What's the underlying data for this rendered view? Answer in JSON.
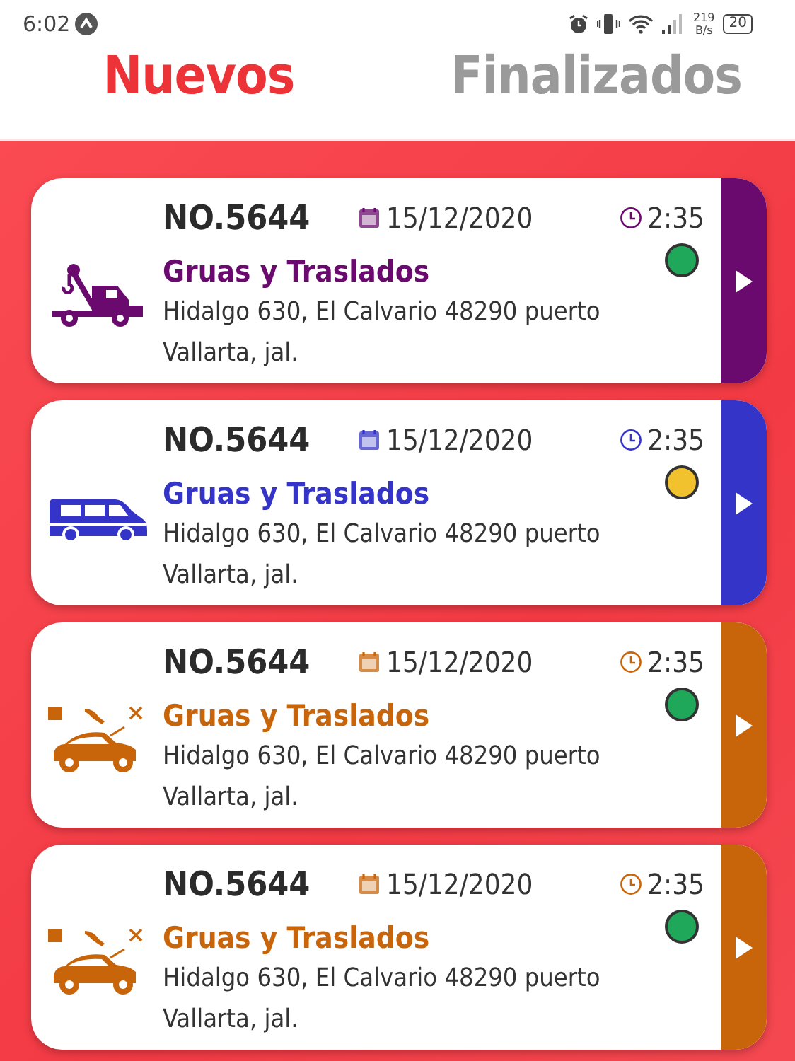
{
  "status_bar": {
    "time": "6:02",
    "speed_value": "219",
    "speed_unit": "B/s",
    "battery": "20"
  },
  "tabs": [
    {
      "label": "Nuevos",
      "selected": true
    },
    {
      "label": "Finalizados",
      "selected": false
    }
  ],
  "services": [
    {
      "kind": "tow",
      "color": "#6b0a6e",
      "number": "NO.5644",
      "date": "15/12/2020",
      "time": "2:35",
      "title": "Gruas y Traslados",
      "address": "Hidalgo 630, El Calvario 48290 puerto Vallarta, jal.",
      "status_dot": {
        "color": "#1fa85a"
      }
    },
    {
      "kind": "van",
      "color": "#3434c8",
      "number": "NO.5644",
      "date": "15/12/2020",
      "time": "2:35",
      "title": "Gruas y Traslados",
      "address": "Hidalgo 630, El Calvario 48290 puerto Vallarta, jal.",
      "status_dot": {
        "color": "#f2c12e"
      }
    },
    {
      "kind": "repair",
      "color": "#c8650a",
      "number": "NO.5644",
      "date": "15/12/2020",
      "time": "2:35",
      "title": "Gruas y Traslados",
      "address": "Hidalgo 630, El Calvario 48290 puerto Vallarta, jal.",
      "status_dot": {
        "color": "#1fa85a"
      }
    },
    {
      "kind": "repair",
      "color": "#c8650a",
      "number": "NO.5644",
      "date": "15/12/2020",
      "time": "2:35",
      "title": "Gruas y Traslados",
      "address": "Hidalgo 630, El Calvario 48290 puerto Vallarta, jal.",
      "status_dot": {
        "color": "#1fa85a"
      }
    }
  ]
}
